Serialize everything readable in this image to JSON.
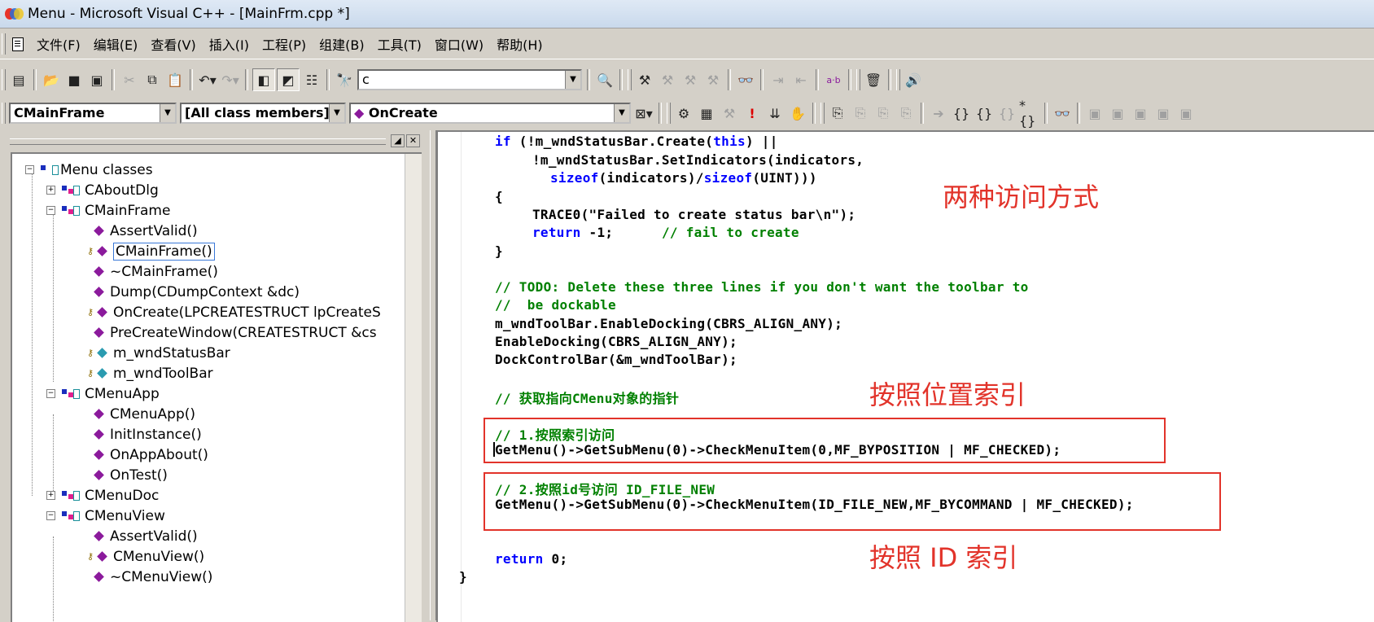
{
  "window": {
    "title": "Menu - Microsoft Visual C++ - [MainFrm.cpp *]"
  },
  "menu": [
    "文件(F)",
    "编辑(E)",
    "查看(V)",
    "插入(I)",
    "工程(P)",
    "组建(B)",
    "工具(T)",
    "窗口(W)",
    "帮助(H)"
  ],
  "toolbar": {
    "find_value": "c"
  },
  "wizardbar": {
    "class_combo": "CMainFrame",
    "filter_combo": "[All class members]",
    "member_combo": "OnCreate"
  },
  "tree": {
    "root": "Menu classes",
    "items": [
      "CAboutDlg",
      "CMainFrame",
      "AssertValid()",
      "CMainFrame()",
      "~CMainFrame()",
      "Dump(CDumpContext &dc)",
      "OnCreate(LPCREATESTRUCT lpCreateS",
      "PreCreateWindow(CREATESTRUCT &cs",
      "m_wndStatusBar",
      "m_wndToolBar",
      "CMenuApp",
      "CMenuApp()",
      "InitInstance()",
      "OnAppAbout()",
      "OnTest()",
      "CMenuDoc",
      "CMenuView",
      "AssertValid()",
      "CMenuView()",
      "~CMenuView()"
    ]
  },
  "code": {
    "l1_kw": "if",
    "l1_a": " (!m_wndStatusBar.Create(",
    "l1_this": "this",
    "l1_b": ") ||",
    "l2": "!m_wndStatusBar.SetIndicators(indicators,",
    "l3_sizeof1": "sizeof",
    "l3_a": "(indicators)/",
    "l3_sizeof2": "sizeof",
    "l3_b": "(UINT)))",
    "l4": "{",
    "l5": "TRACE0(\"Failed to create status bar\\n\");",
    "l6_kw": "return",
    "l6_a": " -1;      ",
    "l6_cm": "// fail to create",
    "l7": "}",
    "c1": "// TODO: Delete these three lines if you don't want the toolbar to",
    "c2": "//  be dockable",
    "l8": "m_wndToolBar.EnableDocking(CBRS_ALIGN_ANY);",
    "l9": "EnableDocking(CBRS_ALIGN_ANY);",
    "l10": "DockControlBar(&m_wndToolBar);",
    "c3": "// 获取指向CMenu对象的指针",
    "c4": "// 1.按照索引访问",
    "l11": "GetMenu()->GetSubMenu(0)->CheckMenuItem(0,MF_BYPOSITION | MF_CHECKED);",
    "c5": "// 2.按照id号访问 ID_FILE_NEW",
    "l12": "GetMenu()->GetSubMenu(0)->CheckMenuItem(ID_FILE_NEW,MF_BYCOMMAND | MF_CHECKED);",
    "l13_kw": "return",
    "l13_a": " 0;",
    "l14": "}"
  },
  "annotations": {
    "a1": "两种访问方式",
    "a2": "按照位置索引",
    "a3": "按照 ID 索引"
  },
  "colors": {
    "annotation": "#e2332a",
    "keyword": "#0000ff",
    "comment": "#008000"
  }
}
